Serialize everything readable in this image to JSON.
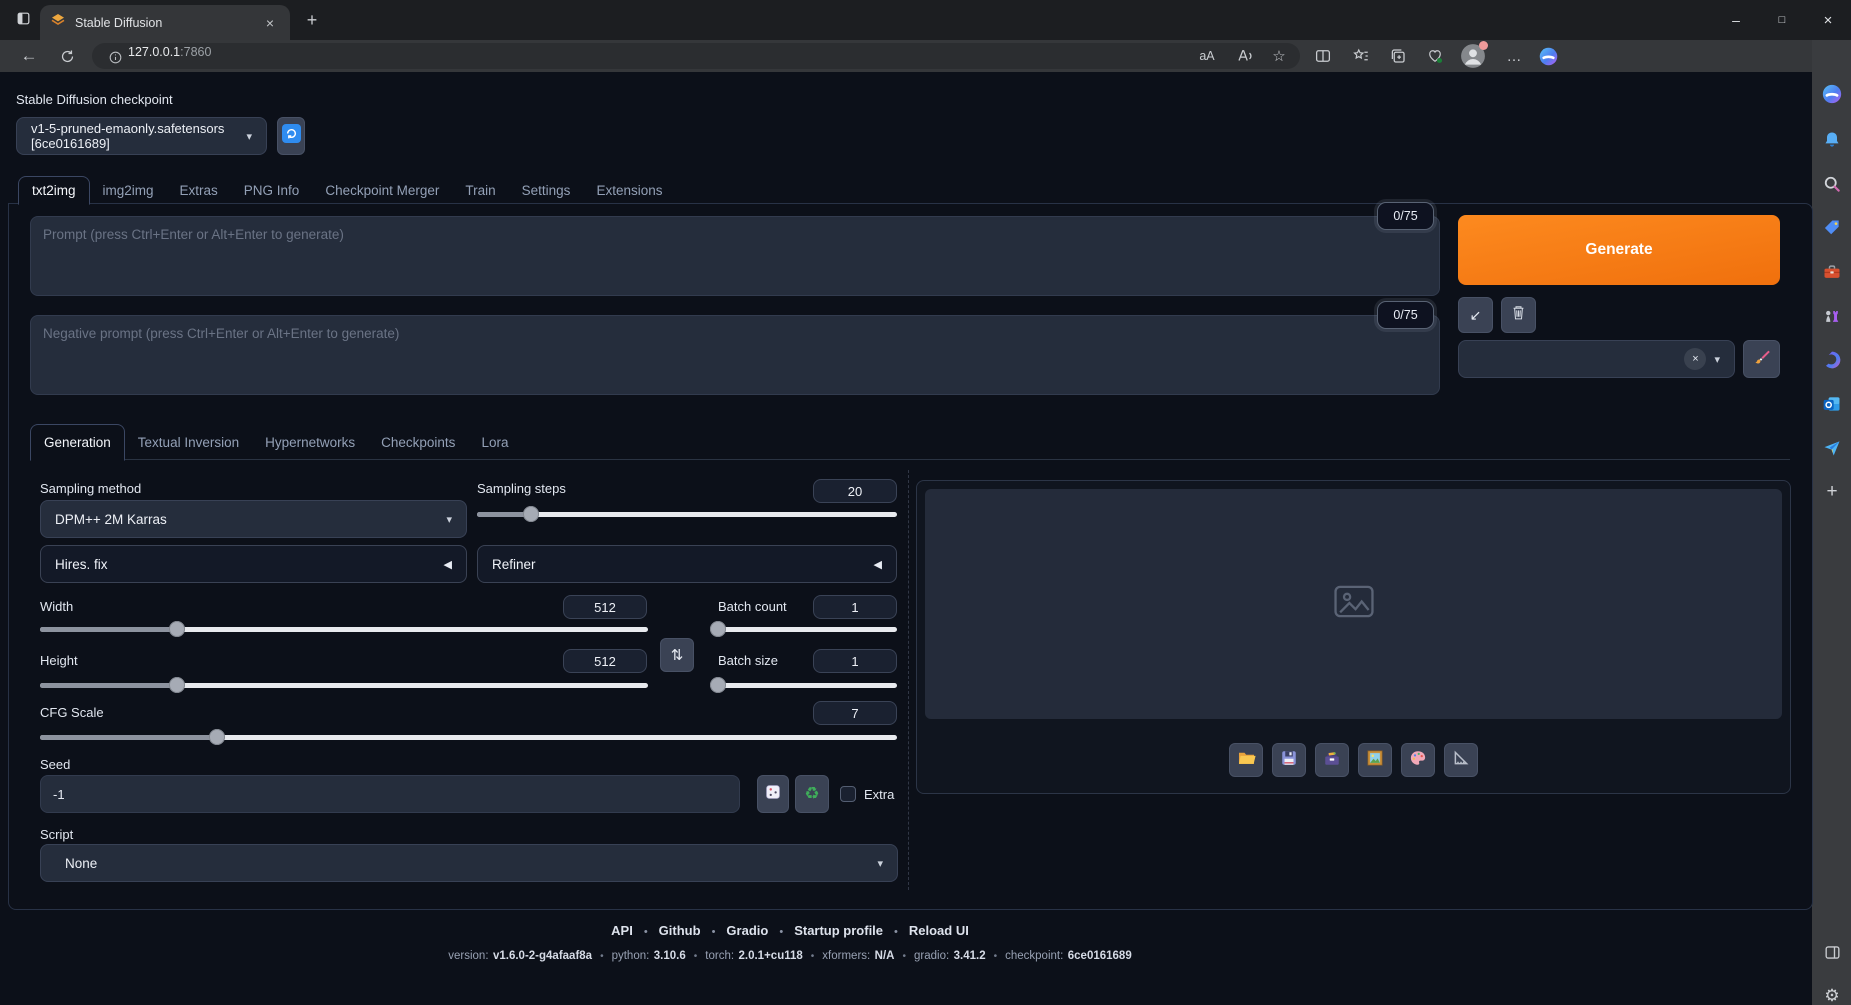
{
  "browser": {
    "tab_title": "Stable Diffusion",
    "url": {
      "host": "127.0.0.1",
      "port": ":7860"
    }
  },
  "glyphs": {
    "new_tab": "+",
    "close_tab": "×",
    "minimize": "–",
    "maximize": "□",
    "close": "×",
    "back": "←",
    "star": "☆",
    "translate": "aA",
    "ellipsis": "…",
    "caret": "▾",
    "accordion_collapsed": "◀",
    "swap": "⇅",
    "send_arrow": "↙",
    "recycle": "♻",
    "gear": "⚙",
    "plus": "+",
    "clear": "×"
  },
  "app": {
    "checkpoint": {
      "label": "Stable Diffusion checkpoint",
      "value": "v1-5-pruned-emaonly.safetensors [6ce0161689]"
    },
    "main_tabs": [
      "txt2img",
      "img2img",
      "Extras",
      "PNG Info",
      "Checkpoint Merger",
      "Train",
      "Settings",
      "Extensions"
    ],
    "prompt": {
      "placeholder": "Prompt (press Ctrl+Enter or Alt+Enter to generate)",
      "counter": "0/75"
    },
    "negative_prompt": {
      "placeholder": "Negative prompt (press Ctrl+Enter or Alt+Enter to generate)",
      "counter": "0/75"
    },
    "generate_label": "Generate",
    "sub_tabs": [
      "Generation",
      "Textual Inversion",
      "Hypernetworks",
      "Checkpoints",
      "Lora"
    ],
    "settings": {
      "sampling_method": {
        "label": "Sampling method",
        "value": "DPM++ 2M Karras"
      },
      "sampling_steps": {
        "label": "Sampling steps",
        "value": "20",
        "percent": 12.8
      },
      "hires_fix": {
        "label": "Hires. fix"
      },
      "refiner": {
        "label": "Refiner"
      },
      "width": {
        "label": "Width",
        "value": "512",
        "percent": 22.6
      },
      "height": {
        "label": "Height",
        "value": "512",
        "percent": 22.6
      },
      "batch_count": {
        "label": "Batch count",
        "value": "1",
        "percent": 0
      },
      "batch_size": {
        "label": "Batch size",
        "value": "1",
        "percent": 0
      },
      "cfg_scale": {
        "label": "CFG Scale",
        "value": "7",
        "percent": 20.7
      },
      "seed": {
        "label": "Seed",
        "value": "-1",
        "extra_label": "Extra"
      },
      "script": {
        "label": "Script",
        "value": "None"
      }
    },
    "footer": {
      "links": [
        "API",
        "Github",
        "Gradio",
        "Startup profile",
        "Reload UI"
      ],
      "version": [
        {
          "label": "version:",
          "value": "v1.6.0-2-g4afaaf8a"
        },
        {
          "label": "python:",
          "value": "3.10.6"
        },
        {
          "label": "torch:",
          "value": "2.0.1+cu118"
        },
        {
          "label": "xformers:",
          "value": "N/A"
        },
        {
          "label": "gradio:",
          "value": "3.41.2"
        },
        {
          "label": "checkpoint:",
          "value": "6ce0161689"
        }
      ]
    }
  },
  "colors": {
    "accent_orange": "#f1730e",
    "page_bg": "#0c1019",
    "chrome_bg": "#35373a",
    "input_bg": "#252d3c",
    "blue_accent": "#2f8cf0"
  }
}
